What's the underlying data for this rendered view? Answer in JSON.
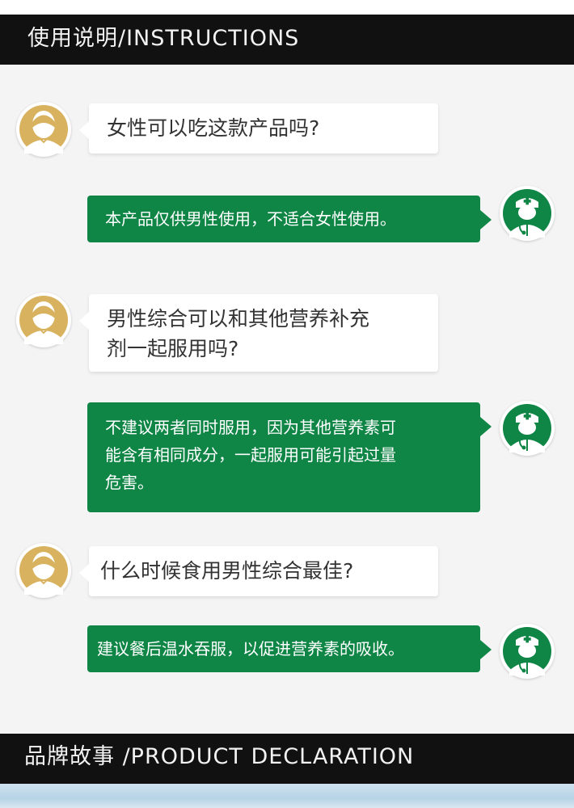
{
  "header": {
    "title": "使用说明/INSTRUCTIONS"
  },
  "conversation": [
    {
      "question": "女性可以吃这款产品吗?",
      "answer": "本产品仅供男性使用，不适合女性使用。"
    },
    {
      "question_lines": [
        "男性综合可以和其他营养补充",
        "剂一起服用吗?"
      ],
      "answer_lines": [
        "不建议两者同时服用，因为其他营养素可",
        "能含有相同成分，一起服用可能引起过量",
        "危害。"
      ]
    },
    {
      "question": "什么时候食用男性综合最佳?",
      "answer": "建议餐后温水吞服，以促进营养素的吸收。"
    }
  ],
  "footer": {
    "title": "品牌故事 /PRODUCT DECLARATION"
  },
  "icons": {
    "user": "woman-avatar-icon",
    "doctor": "doctor-avatar-icon"
  },
  "colors": {
    "answer_bubble": "#0f8546",
    "header_bg": "#111111",
    "avatar_gold": "#d8b25e"
  }
}
